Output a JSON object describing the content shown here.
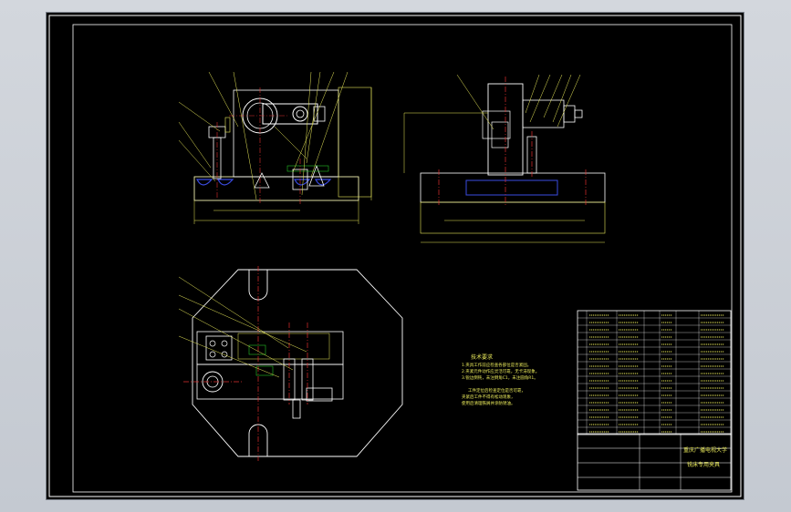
{
  "drawing": {
    "notes": {
      "title": "技术要求",
      "lines": [
        "1.夹具工作前应检查各部位是否紧固。",
        "2.夹紧元件动作应灵活可靠，无卡滞现象。",
        "3.锐边倒钝，未注倒角C1，未注圆角R1。"
      ],
      "extra": [
        "工件定位后检查定位是否可靠，",
        "夹紧后工件不得有松动现象，",
        "使用后清理铁屑并涂防锈油。"
      ]
    },
    "title_block": {
      "school": "重庆广播电视大学",
      "drawing_name": "铣床专用夹具"
    },
    "colors": {
      "outline": "#e8e85a",
      "frame": "#26c026",
      "center": "#e03030",
      "leader": "#e8e85a",
      "hatch": "#3a4be0",
      "part": "#ffffff",
      "green": "#2fd22f"
    }
  }
}
